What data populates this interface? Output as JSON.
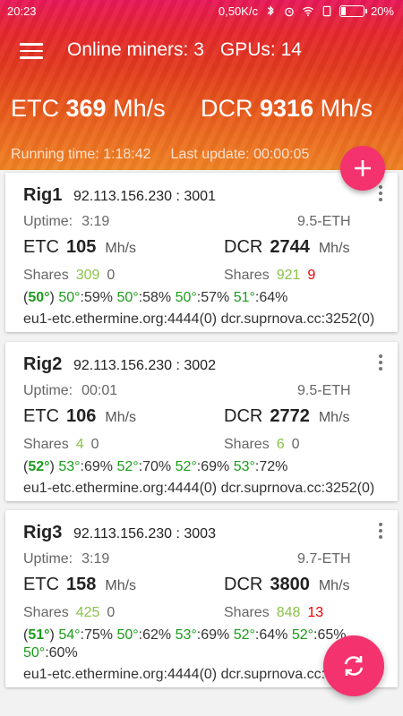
{
  "status_bar": {
    "time": "20:23",
    "network_speed": "0,50K/c",
    "battery": "20%",
    "icons": [
      "bluetooth-icon",
      "alarm-icon",
      "wifi-icon",
      "sim-icon",
      "battery-icon"
    ]
  },
  "header": {
    "online_miners": "Online miners: 3",
    "gpus": "GPUs: 14",
    "etc_label": "ETC",
    "etc_value": "369",
    "etc_unit": "Mh/s",
    "dcr_label": "DCR",
    "dcr_value": "9316",
    "dcr_unit": "Mh/s",
    "running_time": "Running time: 1:18:42",
    "last_update": "Last update: 00:00:05"
  },
  "labels": {
    "uptime": "Uptime:",
    "etc": "ETC",
    "dcr": "DCR",
    "unit": "Mh/s",
    "shares": "Shares"
  },
  "rigs": [
    {
      "name": "Rig1",
      "address": "92.113.156.230 : 3001",
      "uptime": "3:19",
      "version": "9.5-ETH",
      "etc_rate": "105",
      "dcr_rate": "2744",
      "etc_shares_accepted": "309",
      "etc_shares_rejected": "0",
      "dcr_shares_accepted": "921",
      "dcr_shares_rejected": "9",
      "temps": "(50°) 50°:59% 50°:58% 50°:57% 51°:64%",
      "pools": "eu1-etc.ethermine.org:4444(0) dcr.suprnova.cc:3252(0)"
    },
    {
      "name": "Rig2",
      "address": "92.113.156.230 : 3002",
      "uptime": "00:01",
      "version": "9.5-ETH",
      "etc_rate": "106",
      "dcr_rate": "2772",
      "etc_shares_accepted": "4",
      "etc_shares_rejected": "0",
      "dcr_shares_accepted": "6",
      "dcr_shares_rejected": "0",
      "temps": "(52°) 53°:69% 52°:70% 52°:69% 53°:72%",
      "pools": "eu1-etc.ethermine.org:4444(0) dcr.suprnova.cc:3252(0)"
    },
    {
      "name": "Rig3",
      "address": "92.113.156.230 : 3003",
      "uptime": "3:19",
      "version": "9.7-ETH",
      "etc_rate": "158",
      "dcr_rate": "3800",
      "etc_shares_accepted": "425",
      "etc_shares_rejected": "0",
      "dcr_shares_accepted": "848",
      "dcr_shares_rejected": "13",
      "temps": "(51°) 54°:75% 50°:62% 53°:69% 52°:64% 52°:65% 50°:60%",
      "pools": "eu1-etc.ethermine.org:4444(0) dcr.suprnova.cc:3252(0)"
    }
  ],
  "colors": {
    "accent": "#f4326d",
    "accepted": "#8bc34a",
    "rejected": "#e00000",
    "temperature": "#1a9c1a"
  }
}
